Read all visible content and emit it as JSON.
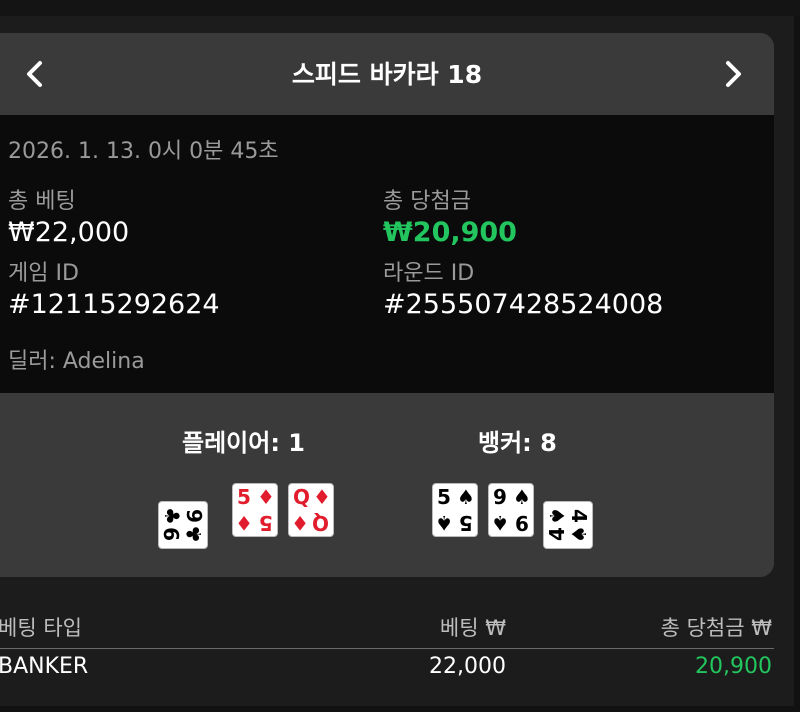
{
  "header": {
    "title": "스피드 바카라 18"
  },
  "details": {
    "datetime": "2026. 1. 13. 0시 0분 45초",
    "total_bet_label": "총 베팅",
    "total_bet_value": "₩22,000",
    "total_win_label": "총 당첨금",
    "total_win_value": "₩20,900",
    "game_id_label": "게임 ID",
    "game_id_value": "#12115292624",
    "round_id_label": "라운드 ID",
    "round_id_value": "#255507428524008",
    "dealer": "딜러: Adelina"
  },
  "hands": {
    "player": {
      "label": "플레이어: 1",
      "cards": [
        {
          "rank": "9",
          "suit": "♣",
          "color": "#000000",
          "sideways": true
        },
        {
          "rank": "5",
          "suit": "♦",
          "color": "#e11d2d",
          "sideways": false
        },
        {
          "rank": "Q",
          "suit": "♦",
          "color": "#e11d2d",
          "sideways": false
        }
      ]
    },
    "banker": {
      "label": "뱅커: 8",
      "cards": [
        {
          "rank": "5",
          "suit": "♠",
          "color": "#000000",
          "sideways": false
        },
        {
          "rank": "9",
          "suit": "♠",
          "color": "#000000",
          "sideways": false
        },
        {
          "rank": "4",
          "suit": "♠",
          "color": "#000000",
          "sideways": true
        }
      ]
    }
  },
  "bets_table": {
    "headers": [
      "베팅 타입",
      "베팅 ₩",
      "총 당첨금 ₩"
    ],
    "rows": [
      {
        "type": "BANKER",
        "bet": "22,000",
        "win": "20,900"
      }
    ]
  },
  "colors": {
    "win": "#22c55e",
    "red_suit": "#e11d2d",
    "panel": "#3a3a3a",
    "details_bg": "#0b0b0b"
  },
  "icons": {
    "prev": "chevron-left-icon",
    "next": "chevron-right-icon"
  }
}
